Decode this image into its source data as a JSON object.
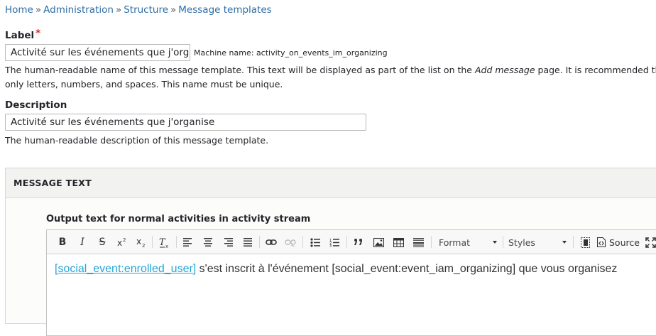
{
  "breadcrumb": {
    "items": [
      "Home",
      "Administration",
      "Structure",
      "Message templates"
    ],
    "separator": "»"
  },
  "label_field": {
    "label": "Label",
    "required_mark": "*",
    "value": "Activité sur les événements que j'organise",
    "machine_name": "Machine name: activity_on_events_im_organizing",
    "help_line1_pre": "The human-readable name of this message template. This text will be displayed as part of the list on the ",
    "help_line1_em": "Add message",
    "help_line1_post": " page. It is recommended that",
    "help_line2": "only letters, numbers, and spaces. This name must be unique."
  },
  "description_field": {
    "label": "Description",
    "value": "Activité sur les événements que j'organise",
    "help": "The human-readable description of this message template."
  },
  "message_text_panel": {
    "title": "MESSAGE TEXT",
    "field_label": "Output text for normal activities in activity stream",
    "toolbar": {
      "bold": "B",
      "italic": "I",
      "strike": "S",
      "format_label": "Format",
      "styles_label": "Styles",
      "source_label": "Source"
    },
    "content": {
      "token": "[social_event:enrolled_user]",
      "text": " s'est inscrit à l'événement [social_event:event_iam_organizing] que vous organisez"
    }
  },
  "colors": {
    "link": "#2e6da4",
    "required": "#dc2323",
    "token": "#27a5d6"
  }
}
